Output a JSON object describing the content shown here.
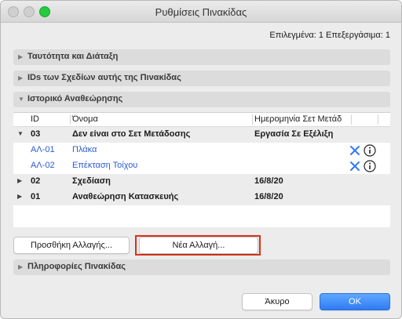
{
  "window": {
    "title": "Ρυθμίσεις Πινακίδας"
  },
  "selection_info": "Επιλεγμένα: 1 Επεξεργάσιμα: 1",
  "sections": {
    "identity": "Ταυτότητα και Διάταξη",
    "drawing_ids": "IDs των Σχεδίων αυτής της Πινακίδας",
    "revision_history": "Ιστορικό Αναθεώρησης",
    "sheet_info": "Πληροφορίες Πινακίδας"
  },
  "table": {
    "columns": [
      "ID",
      "Όνομα",
      "Ημερομηνία Σετ Μετάδ"
    ],
    "rows": [
      {
        "type": "group",
        "expanded": true,
        "id": "03",
        "name": "Δεν είναι στο Σετ Μετάδοσης",
        "date": "Εργασία Σε Εξέλιξη"
      },
      {
        "type": "item",
        "id": "ΑΛ-01",
        "name": "Πλάκα",
        "actions": [
          "close-icon",
          "info-icon"
        ]
      },
      {
        "type": "item",
        "id": "ΑΛ-02",
        "name": "Επέκταση Τοίχου",
        "actions": [
          "close-icon",
          "info-icon"
        ]
      },
      {
        "type": "group",
        "expanded": false,
        "id": "02",
        "name": "Σχεδίαση",
        "date": "16/8/20"
      },
      {
        "type": "group",
        "expanded": false,
        "id": "01",
        "name": "Αναθεώρηση Κατασκευής",
        "date": "16/8/20"
      }
    ]
  },
  "buttons": {
    "add_change": "Προσθήκη Αλλαγής...",
    "new_change": "Νέα Αλλαγή...",
    "cancel": "Άκυρο",
    "ok": "OK"
  },
  "colors": {
    "accent": "#2f7bf2",
    "highlight": "#d8311b",
    "link": "#2a5cd6"
  }
}
